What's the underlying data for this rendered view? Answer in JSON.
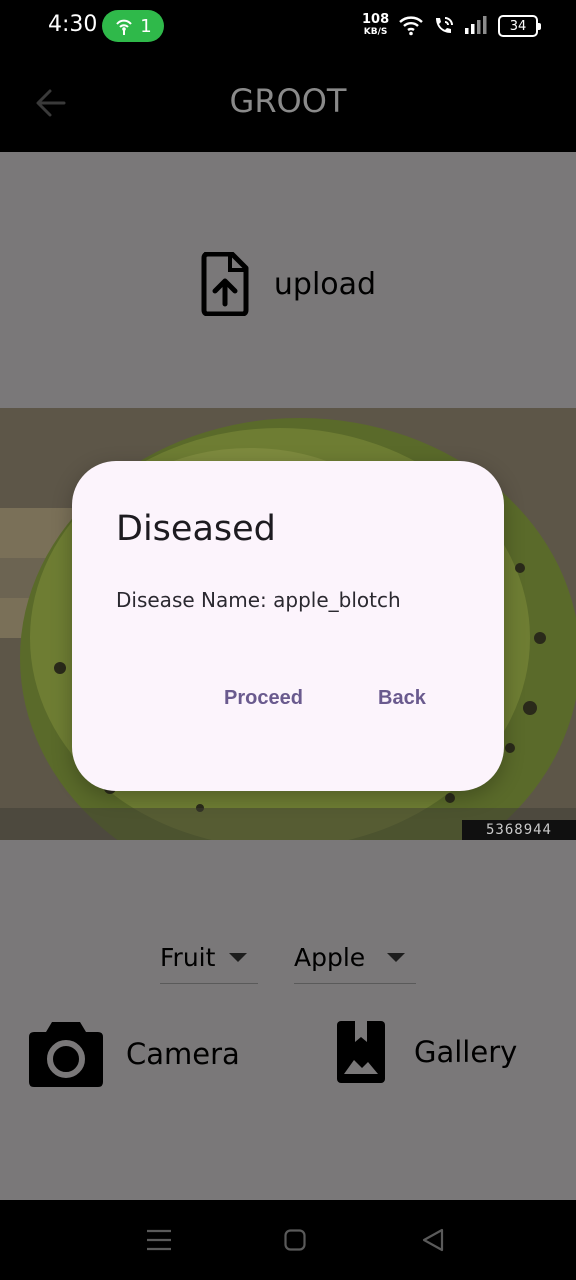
{
  "status_bar": {
    "time": "4:30",
    "hotspot_count": "1",
    "net_speed_value": "108",
    "net_speed_unit": "KB/S",
    "battery": "34"
  },
  "app_bar": {
    "title": "GROOT",
    "back_icon": "arrow-left-icon"
  },
  "upload": {
    "label": "upload",
    "icon": "file-upload-icon"
  },
  "photo": {
    "id_label": "5368944"
  },
  "selectors": {
    "category": "Fruit",
    "plant": "Apple"
  },
  "actions": {
    "camera_label": "Camera",
    "gallery_label": "Gallery"
  },
  "dialog": {
    "title": "Diseased",
    "body": "Disease Name: apple_blotch",
    "proceed_label": "Proceed",
    "back_label": "Back"
  },
  "colors": {
    "accent": "#6a5a8e",
    "dialog_bg": "#fcf4fc",
    "scrim": "#7a7879",
    "hotspot_pill": "#2fb94a"
  }
}
